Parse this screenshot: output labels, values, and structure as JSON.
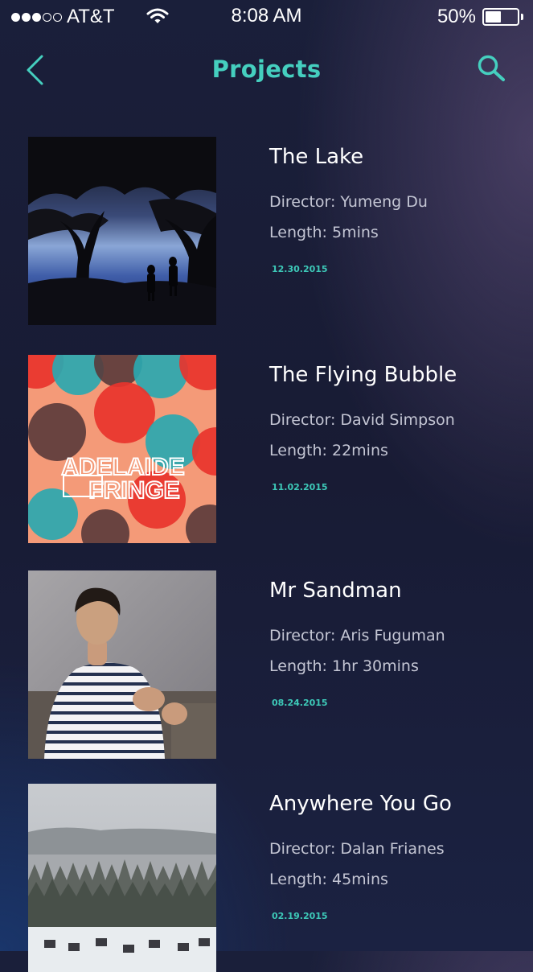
{
  "status_bar": {
    "carrier": "AT&T",
    "signal_bars_filled": 3,
    "signal_bars_total": 5,
    "time": "8:08 AM",
    "battery_percent": "50%",
    "battery_level": 0.5
  },
  "nav": {
    "title": "Projects",
    "back_icon": "chevron-left-icon",
    "search_icon": "search-icon"
  },
  "colors": {
    "accent": "#45cfbf",
    "date": "#3dc9b8",
    "meta_text": "#c4c6d4"
  },
  "projects": [
    {
      "title": "The Lake",
      "director": "Director: Yumeng Du",
      "length": "Length: 5mins",
      "date": "12.30.2015"
    },
    {
      "title": "The Flying Bubble",
      "director": "Director: David Simpson",
      "length": "Length: 22mins",
      "date": "11.02.2015",
      "poster_text": [
        "ADELAIDE",
        "FRINGE"
      ]
    },
    {
      "title": "Mr Sandman",
      "director": "Director: Aris Fuguman",
      "length": "Length: 1hr 30mins",
      "date": "08.24.2015"
    },
    {
      "title": "Anywhere You Go",
      "director": "Director: Dalan Frianes",
      "length": "Length: 45mins",
      "date": "02.19.2015"
    }
  ]
}
